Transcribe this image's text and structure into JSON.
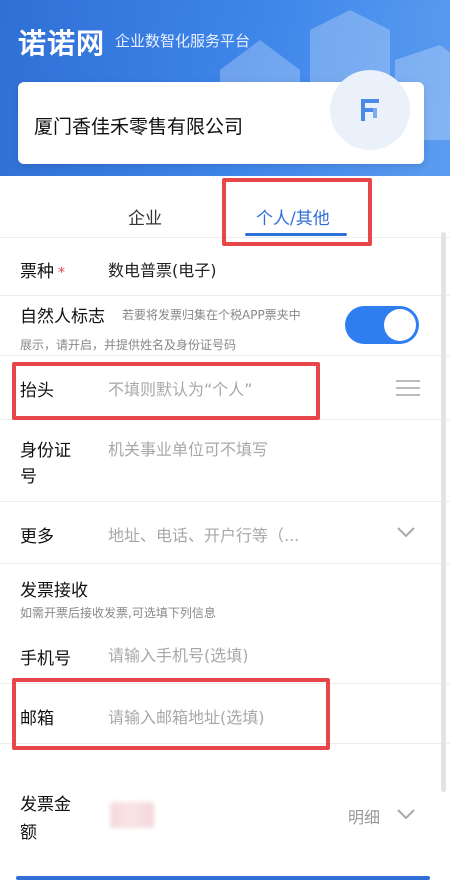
{
  "brand": {
    "name": "诺诺网",
    "subtitle": "企业数智化服务平台"
  },
  "company": {
    "name": "厦门香佳禾零售有限公司"
  },
  "tabs": [
    {
      "label": "企业",
      "active": false
    },
    {
      "label": "个人/其他",
      "active": true
    }
  ],
  "form": {
    "ticket_type": {
      "label": "票种",
      "required_mark": "*",
      "value": "数电普票(电子)"
    },
    "natural_person": {
      "label": "自然人标志",
      "hint_line1": "若要将发票归集在个税APP票夹中",
      "hint_line2": "展示，请开启，并提供姓名及身份证号码",
      "enabled": true
    },
    "header": {
      "label": "抬头",
      "placeholder": "不填则默认为“个人”"
    },
    "id_number": {
      "label_line1": "身份证",
      "label_line2": "号",
      "placeholder": "机关事业单位可不填写"
    },
    "more": {
      "label": "更多",
      "placeholder": "地址、电话、开户行等（..."
    },
    "receive": {
      "label": "发票接收",
      "hint": "如需开票后接收发票,可选填下列信息"
    },
    "phone": {
      "label": "手机号",
      "placeholder": "请输入手机号(选填)"
    },
    "email": {
      "label": "邮箱",
      "placeholder": "请输入邮箱地址(选填)"
    },
    "amount": {
      "label_line1": "发票金",
      "label_line2": "额",
      "detail_label": "明细"
    }
  },
  "colors": {
    "accent": "#2f6fd6",
    "highlight": "#e8474a"
  }
}
